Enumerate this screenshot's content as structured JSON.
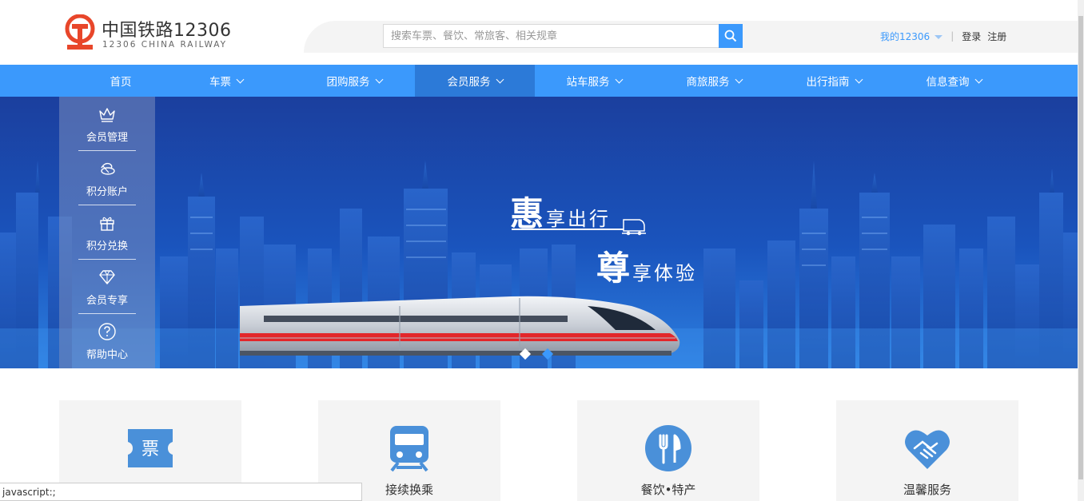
{
  "header": {
    "logo_title": "中国铁路12306",
    "logo_subtitle": "12306 CHINA RAILWAY",
    "search_placeholder": "搜索车票、餐饮、常旅客、相关规章",
    "my_account": "我的12306",
    "separator": "|",
    "login": "登录",
    "register": "注册"
  },
  "nav": {
    "items": [
      {
        "label": "首页",
        "has_dropdown": false,
        "active": false
      },
      {
        "label": "车票",
        "has_dropdown": true,
        "active": false
      },
      {
        "label": "团购服务",
        "has_dropdown": true,
        "active": false
      },
      {
        "label": "会员服务",
        "has_dropdown": true,
        "active": true
      },
      {
        "label": "站车服务",
        "has_dropdown": true,
        "active": false
      },
      {
        "label": "商旅服务",
        "has_dropdown": true,
        "active": false
      },
      {
        "label": "出行指南",
        "has_dropdown": true,
        "active": false
      },
      {
        "label": "信息查询",
        "has_dropdown": true,
        "active": false
      }
    ]
  },
  "side_menu": {
    "items": [
      {
        "label": "会员管理",
        "icon": "crown-icon"
      },
      {
        "label": "积分账户",
        "icon": "coins-icon"
      },
      {
        "label": "积分兑换",
        "icon": "gift-icon"
      },
      {
        "label": "会员专享",
        "icon": "diamond-icon"
      },
      {
        "label": "帮助中心",
        "icon": "help-icon"
      }
    ]
  },
  "banner": {
    "slogan1_big": "惠",
    "slogan1_rest": "享出行",
    "slogan2_big": "尊",
    "slogan2_rest": "享体验",
    "slides_total": 2,
    "slide_active": 1
  },
  "cards": [
    {
      "label": "",
      "icon": "ticket-icon",
      "icon_text": "票"
    },
    {
      "label": "接续换乘",
      "icon": "train-icon"
    },
    {
      "label": "餐饮•特产",
      "icon": "dining-icon"
    },
    {
      "label": "温馨服务",
      "icon": "handshake-heart-icon"
    }
  ],
  "status_bar": {
    "text": "javascript:;"
  },
  "colors": {
    "accent": "#3b99fc",
    "nav_active": "#2c7ad8",
    "brand_red": "#e8462a",
    "banner_dark": "#1b4fb0"
  }
}
